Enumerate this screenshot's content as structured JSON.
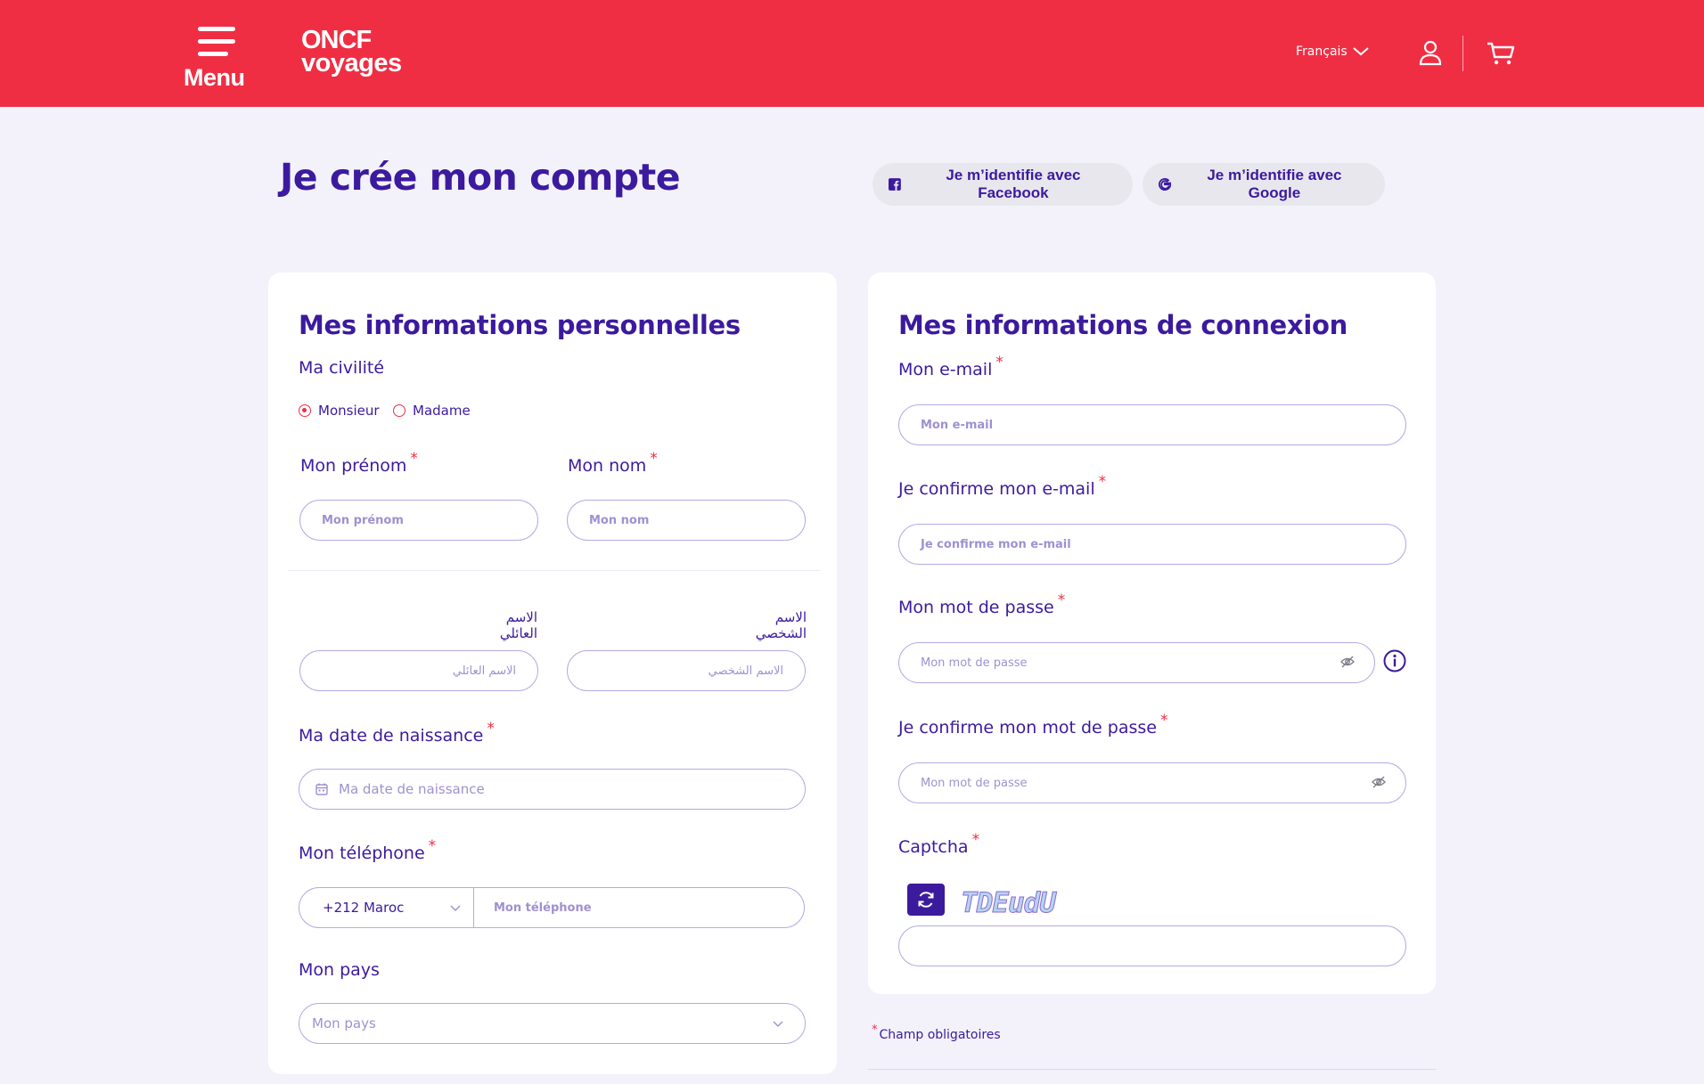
{
  "header": {
    "menu_label": "Menu",
    "logo_line1": "ONCF",
    "logo_line2": "voyages",
    "language": "Français"
  },
  "page": {
    "title": "Je crée mon compte",
    "facebook_button": "Je m’identifie avec Facebook",
    "google_button": "Je m’identifie avec Google"
  },
  "personal": {
    "heading": "Mes informations personnelles",
    "civility_label": "Ma civilité",
    "civility_options": [
      "Monsieur",
      "Madame"
    ],
    "civility_selected": "Monsieur",
    "firstname_label": "Mon prénom",
    "firstname_placeholder": "Mon prénom",
    "lastname_label": "Mon nom",
    "lastname_placeholder": "Mon nom",
    "ar_lastname_label": "الاسم العائلي",
    "ar_lastname_placeholder": "الاسم العائلي",
    "ar_firstname_label": "الاسم الشخصي",
    "ar_firstname_placeholder": "الاسم الشخصي",
    "birthdate_label": "Ma date de naissance",
    "birthdate_placeholder": "Ma date de naissance",
    "phone_label": "Mon téléphone",
    "phone_country": "+212 Maroc",
    "phone_placeholder": "Mon téléphone",
    "country_label": "Mon pays",
    "country_placeholder": "Mon pays"
  },
  "connection": {
    "heading": "Mes informations de connexion",
    "email_label": "Mon e-mail",
    "email_placeholder": "Mon e-mail",
    "email_confirm_label": "Je confirme mon e-mail",
    "email_confirm_placeholder": "Je confirme mon e-mail",
    "password_label": "Mon mot de passe",
    "password_placeholder": "Mon mot de passe",
    "password_confirm_label": "Je confirme mon mot de passe",
    "password_confirm_placeholder": "Mon mot de passe",
    "captcha_label": "Captcha",
    "captcha_text": "TDEudU"
  },
  "required_star": "*",
  "required_note": "Champ obligatoires",
  "icons": [
    "menu-icon",
    "user-icon",
    "cart-icon",
    "chevron-down-icon",
    "facebook-icon",
    "google-icon",
    "calendar-icon",
    "eye-off-icon",
    "info-icon",
    "refresh-icon"
  ],
  "colors": {
    "brand_red": "#ef2e44",
    "brand_purple": "#3c1a9e",
    "page_bg": "#f3f2fb"
  }
}
